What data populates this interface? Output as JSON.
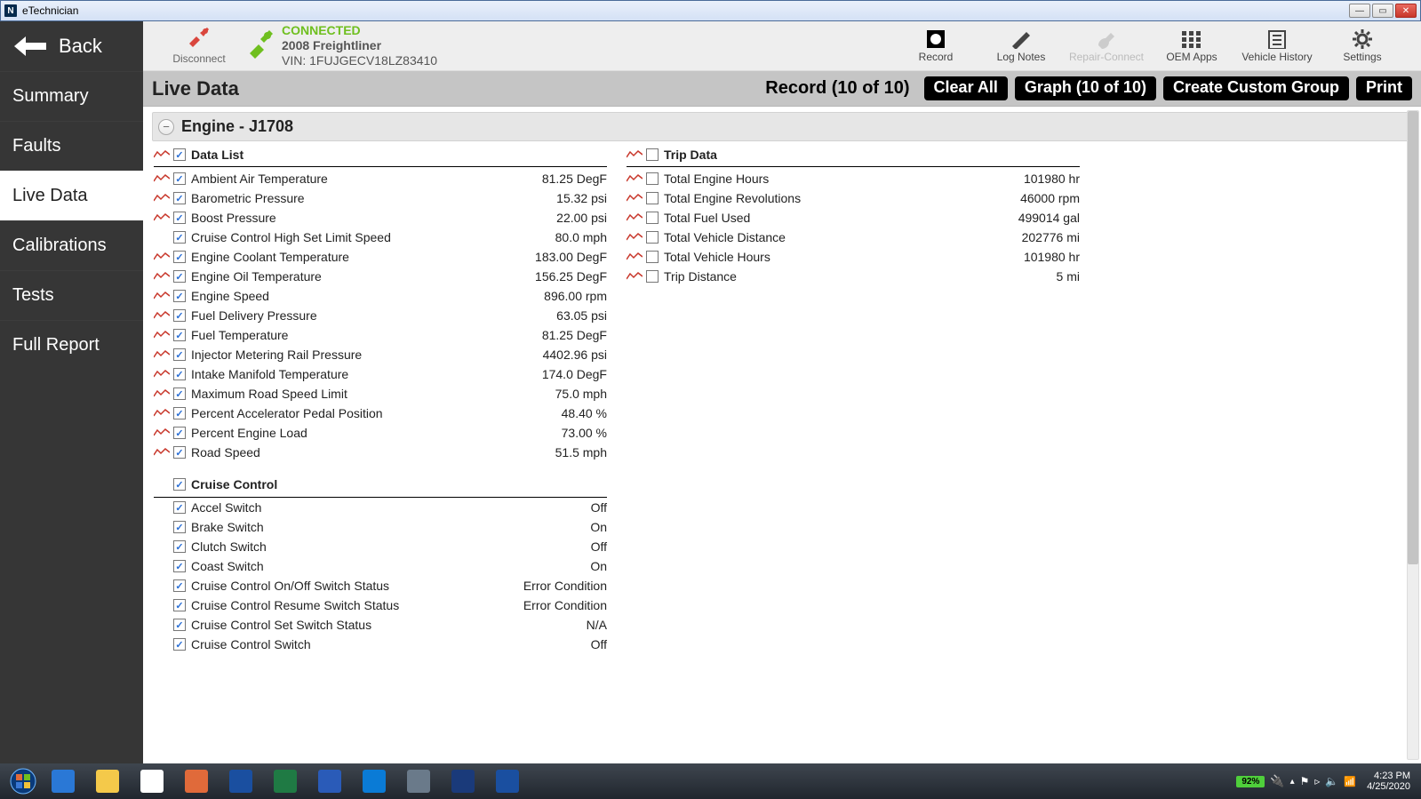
{
  "window": {
    "title": "eTechnician"
  },
  "topbar": {
    "disconnect": "Disconnect",
    "status": "CONNECTED",
    "vehicle": "2008 Freightliner",
    "vin": "VIN: 1FUJGECV18LZ83410",
    "tools": [
      {
        "id": "record",
        "label": "Record"
      },
      {
        "id": "log-notes",
        "label": "Log Notes"
      },
      {
        "id": "repair-connect",
        "label": "Repair-Connect",
        "disabled": true
      },
      {
        "id": "oem-apps",
        "label": "OEM Apps"
      },
      {
        "id": "vehicle-history",
        "label": "Vehicle History"
      },
      {
        "id": "settings",
        "label": "Settings"
      }
    ]
  },
  "sidebar": {
    "back": "Back",
    "items": [
      {
        "id": "summary",
        "label": "Summary",
        "active": false
      },
      {
        "id": "faults",
        "label": "Faults",
        "active": false
      },
      {
        "id": "live-data",
        "label": "Live Data",
        "active": true
      },
      {
        "id": "calibrations",
        "label": "Calibrations",
        "active": false
      },
      {
        "id": "tests",
        "label": "Tests",
        "active": false
      },
      {
        "id": "full-report",
        "label": "Full Report",
        "active": false
      }
    ]
  },
  "subbar": {
    "title": "Live Data",
    "record": "Record (10 of 10)",
    "buttons": {
      "clear_all": "Clear All",
      "graph": "Graph (10 of 10)",
      "custom_group": "Create Custom Group",
      "print": "Print"
    }
  },
  "section": {
    "title": "Engine - J1708"
  },
  "data_list": {
    "header": "Data List",
    "rows": [
      {
        "label": "Ambient Air Temperature",
        "value": "81.25 DegF",
        "checked": true,
        "graph": true
      },
      {
        "label": "Barometric Pressure",
        "value": "15.32 psi",
        "checked": true,
        "graph": true
      },
      {
        "label": "Boost Pressure",
        "value": "22.00 psi",
        "checked": true,
        "graph": true
      },
      {
        "label": "Cruise Control High Set Limit Speed",
        "value": "80.0 mph",
        "checked": true,
        "graph": false
      },
      {
        "label": "Engine Coolant Temperature",
        "value": "183.00 DegF",
        "checked": true,
        "graph": true
      },
      {
        "label": "Engine Oil Temperature",
        "value": "156.25 DegF",
        "checked": true,
        "graph": true
      },
      {
        "label": "Engine Speed",
        "value": "896.00 rpm",
        "checked": true,
        "graph": true
      },
      {
        "label": "Fuel Delivery Pressure",
        "value": "63.05 psi",
        "checked": true,
        "graph": true
      },
      {
        "label": "Fuel Temperature",
        "value": "81.25 DegF",
        "checked": true,
        "graph": true
      },
      {
        "label": "Injector Metering Rail Pressure",
        "value": "4402.96 psi",
        "checked": true,
        "graph": true
      },
      {
        "label": "Intake Manifold Temperature",
        "value": "174.0 DegF",
        "checked": true,
        "graph": true
      },
      {
        "label": "Maximum Road Speed Limit",
        "value": "75.0 mph",
        "checked": true,
        "graph": true
      },
      {
        "label": "Percent Accelerator Pedal Position",
        "value": "48.40 %",
        "checked": true,
        "graph": true
      },
      {
        "label": "Percent Engine Load",
        "value": "73.00 %",
        "checked": true,
        "graph": true
      },
      {
        "label": "Road Speed",
        "value": "51.5 mph",
        "checked": true,
        "graph": true
      }
    ]
  },
  "cruise_control": {
    "header": "Cruise Control",
    "rows": [
      {
        "label": "Accel Switch",
        "value": "Off",
        "checked": true,
        "graph": false
      },
      {
        "label": "Brake Switch",
        "value": "On",
        "checked": true,
        "graph": false
      },
      {
        "label": "Clutch Switch",
        "value": "Off",
        "checked": true,
        "graph": false
      },
      {
        "label": "Coast Switch",
        "value": "On",
        "checked": true,
        "graph": false
      },
      {
        "label": "Cruise Control On/Off Switch Status",
        "value": "Error Condition",
        "checked": true,
        "graph": false
      },
      {
        "label": "Cruise Control Resume Switch Status",
        "value": "Error Condition",
        "checked": true,
        "graph": false
      },
      {
        "label": "Cruise Control Set Switch Status",
        "value": "N/A",
        "checked": true,
        "graph": false
      },
      {
        "label": "Cruise Control Switch",
        "value": "Off",
        "checked": true,
        "graph": false
      }
    ]
  },
  "trip_data": {
    "header": "Trip Data",
    "rows": [
      {
        "label": "Total Engine Hours",
        "value": "101980 hr",
        "checked": false,
        "graph": true
      },
      {
        "label": "Total Engine Revolutions",
        "value": "46000 rpm",
        "checked": false,
        "graph": true
      },
      {
        "label": "Total Fuel Used",
        "value": "499014 gal",
        "checked": false,
        "graph": true
      },
      {
        "label": "Total Vehicle Distance",
        "value": "202776 mi",
        "checked": false,
        "graph": true
      },
      {
        "label": "Total Vehicle Hours",
        "value": "101980 hr",
        "checked": false,
        "graph": true
      },
      {
        "label": "Trip Distance",
        "value": "5 mi",
        "checked": false,
        "graph": true
      }
    ]
  },
  "taskbar": {
    "items": [
      "ie",
      "explorer",
      "chrome",
      "firefox",
      "nexiq",
      "excel",
      "word",
      "teamviewer",
      "printer",
      "mdi",
      "nexiq2"
    ],
    "battery": "92%",
    "time": "4:23 PM",
    "date": "4/25/2020"
  }
}
